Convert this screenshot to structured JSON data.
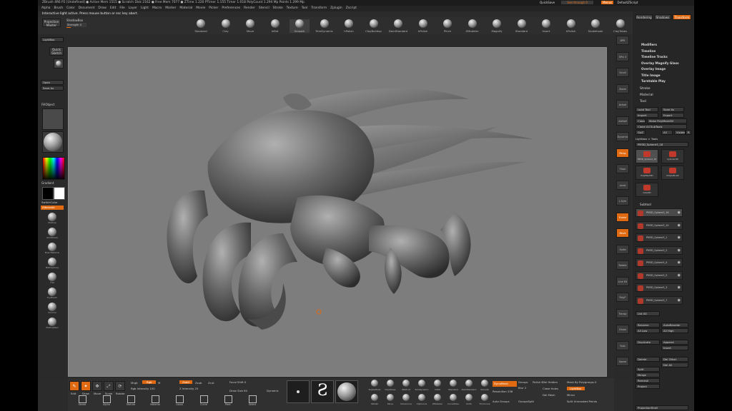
{
  "titlebar": {
    "text": "ZBrush 4R6 P2   [Undefined]   ● Active Mem 1515 ● Scratch Disk 2162 ● Free Mem 7077 ● ZTime 1.220 PTimer 1.155  Timer 1.018  PolyCount 1.294 Mp  Points 1.299 Mp"
  },
  "titlebar_right": {
    "quicksave": "QuickSave",
    "seethrough": "See-through 0",
    "menus": "Menus",
    "defaultscript": "DefaultZScript"
  },
  "menubar": {
    "items": [
      "Alpha",
      "Brush",
      "Color",
      "Document",
      "Draw",
      "Edit",
      "File",
      "Layer",
      "Light",
      "Macro",
      "Marker",
      "Material",
      "Movie",
      "Picker",
      "Preferences",
      "Render",
      "Stencil",
      "Stroke",
      "Texture",
      "Tool",
      "Transform",
      "Zplugin",
      "Zscript"
    ]
  },
  "notice": {
    "text": "Interactive light active. Press mouse button or esc key abort."
  },
  "top_shelf": {
    "projection_master": "Projection Master",
    "lightbox": "LightBox",
    "shadowbox_label": "ShadowBox",
    "strength_label": "Strength 0",
    "brushes": [
      "Standard",
      "Clay",
      "Move",
      "Inflat",
      "Smooth",
      "TrimDynamic",
      "hPolish",
      "ClayBuildup",
      "DamStandard",
      "hPolish",
      "Pinch",
      "ZModeler",
      "Magnify",
      "Standard",
      "Insert",
      "hPolish",
      "Snakehook",
      "ClayTubes"
    ]
  },
  "left_tray": {
    "lightbox": "LightBox",
    "quick_sketch": "Quick Sketch",
    "open": "Open",
    "save_as": "Save As",
    "fill_object": "FillObject",
    "gradient": "Gradient",
    "switch_color": "SwitchColor",
    "alternate": "Alternate",
    "materials": [
      "MatCap",
      "SkinShade",
      "BasicMaterial",
      "MatCapGray",
      "Flat",
      "ToyPlastic",
      "Chrome",
      "MatCapRed"
    ],
    "colors": {
      "white": "#ffffff",
      "black": "#000000",
      "accent": "#e06a12"
    }
  },
  "right_shelf": {
    "buttons": [
      "BPR",
      "SPix 3",
      "Scroll",
      "Zoom",
      "Actual",
      "AAHalf",
      "Dynamic",
      "Persp",
      "Floor",
      "Local",
      "L.Sym",
      "Frame",
      "Move",
      "Scale",
      "Rotate",
      "Line Fill",
      "PolyF",
      "Transp",
      "Ghost",
      "Solo",
      "Xpose"
    ]
  },
  "right_panel": {
    "top_buttons": [
      "Rendering",
      "Shadows",
      "Transform"
    ],
    "menu_items": [
      "Modifiers",
      "Timeline",
      "Timeline Tracks",
      "Overlay Magnify Glass",
      "Overlay Image",
      "Title Image",
      "Turntable Play"
    ],
    "sections": [
      "Stroke",
      "Material",
      "Tool"
    ],
    "tool_buttons": [
      "Load Tool",
      "Save As",
      "Import",
      "Export",
      "Clone",
      "Make PolyMesh3D",
      "Clone All SubTools",
      "GoZ",
      "All",
      "Visible",
      "R"
    ],
    "lightbox_tools": "Lightbox > Tools",
    "current_tool": "PM3D_Sphere3_18",
    "tool_thumbs": [
      "PM3D_Sphere3_18",
      "Cylinder3D",
      "PolyMesh3D",
      "SimpleBrush",
      "Cube3D"
    ],
    "subtool_header": "Subtool",
    "subtools": [
      "PM3D_Sphere3_18",
      "PM3D_Sphere3_10",
      "PM3D_Sphere3_1",
      "PM3D_Sphere3_2",
      "PM3D_Sphere3_4",
      "PM3D_Sphere3_5",
      "PM3D_Sphere3_3",
      "PM3D_Sphere3_7"
    ],
    "list_all": "List All",
    "rename": "Rename",
    "auto_reorder": "AutoReorder",
    "all_low": "All Low",
    "all_high": "All High",
    "duplicate": "Duplicate",
    "append": "Append",
    "insert": "Insert",
    "delete": "Delete",
    "del_other": "Del Other",
    "del_all": "Del All",
    "split": "Split",
    "merge": "Merge",
    "remesh": "Remesh",
    "project": "Project",
    "projection_shell": "ProjectionShell"
  },
  "bottom_shelf": {
    "edit": "Edit",
    "draw": "Draw",
    "move": "Move",
    "scale": "Scale",
    "rotate": "Rotate",
    "mrgb": "Mrgb",
    "rgb": "Rgb",
    "m": "M",
    "zadd": "Zadd",
    "zsub": "Zsub",
    "zcut": "Zcut",
    "rgb_intensity": "Rgb Intensity 100",
    "z_intensity": "Z Intensity 25",
    "focal_shift": "Focal Shift 0",
    "draw_size": "Draw Size 64",
    "dynamic": "Dynamic",
    "brushes_bottom": [
      "SnakeHook",
      "ClayTubes",
      "MAHcut",
      "TrimDynamic",
      "Inflat",
      "Standard",
      "DamStandard",
      "Smooth",
      "hPolish",
      "Move",
      "SliceCurve",
      "ClipCurve",
      "ZModeler",
      "CurveTube",
      "Knife",
      "TrimCurve"
    ],
    "bottom_buttons": [
      "Stroke",
      "Alpha",
      "Texture",
      "Material",
      "Lasso",
      "Curve",
      "Rect",
      "Select"
    ],
    "dynamesh": "DynaMesh",
    "resolution": "Resolution 256",
    "groups": "Groups",
    "polish": "Polish 0",
    "blur": "Blur 2",
    "del_hidden": "Del Hidden",
    "close_holes": "Close Holes",
    "del_mesh": "Del Mesh",
    "mirror": "Mirror",
    "mask_by_polygroups": "Mask By Polygroups 0",
    "lightbox_btn": "LightBox",
    "auto_groups": "Auto Groups",
    "group_visible": "GroupsSplit",
    "split_unmasked": "Split Unmasked Points",
    "spotlight": "Spotlight"
  }
}
